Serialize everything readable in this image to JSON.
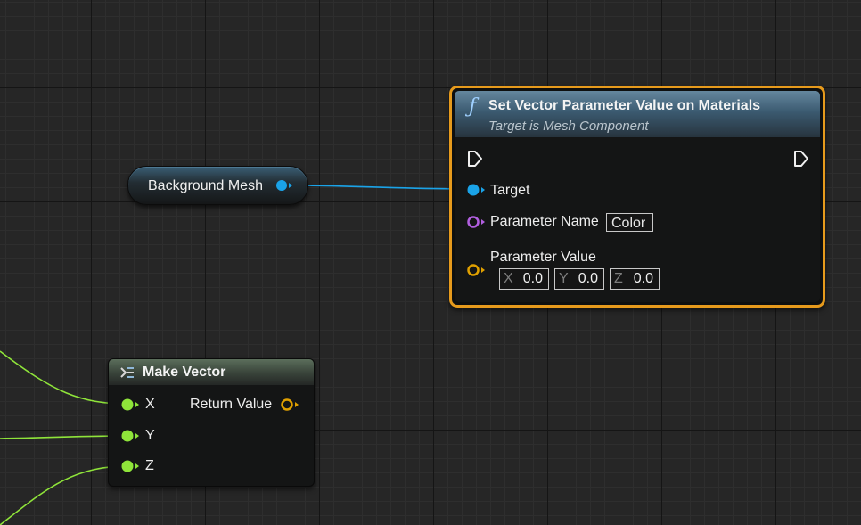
{
  "graph": {
    "colors": {
      "background": "#262626",
      "object_pin": "#1aa3e8",
      "name_pin": "#b25fe0",
      "struct_pin": "#e0a000",
      "float_pin": "#8fe43a",
      "selection_border": "#e69a1c"
    }
  },
  "getter_node": {
    "label": "Background Mesh",
    "pin_type": "object"
  },
  "function_node": {
    "icon": "function-icon",
    "title": "Set Vector Parameter Value on Materials",
    "subtitle": "Target is Mesh Component",
    "selected": true,
    "inputs": {
      "target_label": "Target",
      "parameter_name_label": "Parameter Name",
      "parameter_name_value": "Color",
      "parameter_value_label": "Parameter Value",
      "vector": [
        {
          "axis": "X",
          "value": "0.0"
        },
        {
          "axis": "Y",
          "value": "0.0"
        },
        {
          "axis": "Z",
          "value": "0.0"
        }
      ]
    }
  },
  "make_vector_node": {
    "icon": "make-struct-icon",
    "title": "Make Vector",
    "inputs": [
      "X",
      "Y",
      "Z"
    ],
    "output": "Return Value"
  }
}
